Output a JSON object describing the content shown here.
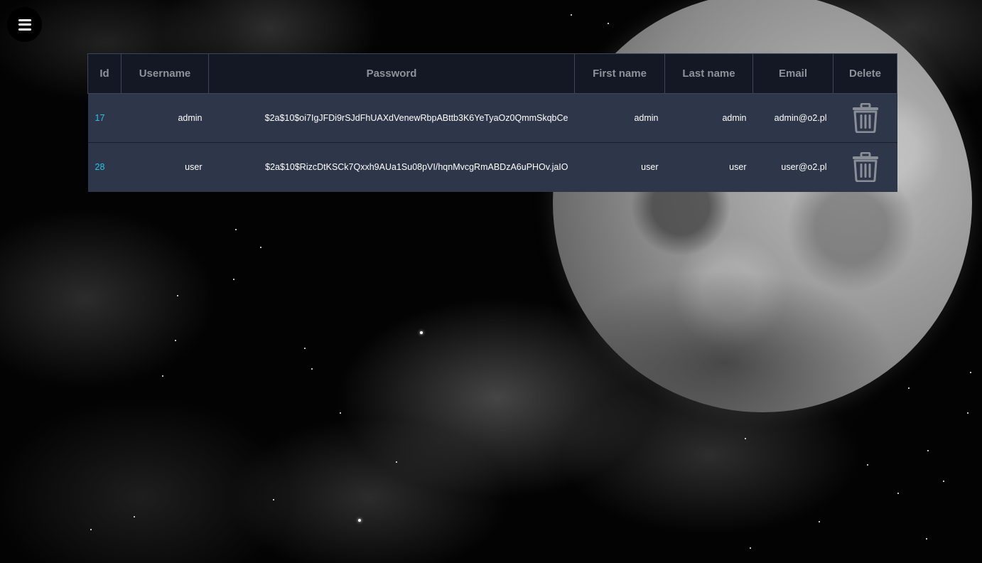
{
  "menu": {
    "icon": "hamburger-menu-icon"
  },
  "table": {
    "headers": [
      "Id",
      "Username",
      "Password",
      "First name",
      "Last name",
      "Email",
      "Delete"
    ],
    "rows": [
      {
        "id": "17",
        "username": "admin",
        "password": "$2a$10$oi7IgJFDi9rSJdFhUAXdVenewRbpABttb3K6YeTyaOz0QmmSkqbCe",
        "first_name": "admin",
        "last_name": "admin",
        "email": "admin@o2.pl",
        "delete_icon": "trash-icon"
      },
      {
        "id": "28",
        "username": "user",
        "password": "$2a$10$RizcDtKSCk7Qxxh9AUa1Su08pVI/hqnMvcgRmABDzA6uPHOv.jaIO",
        "first_name": "user",
        "last_name": "user",
        "email": "user@o2.pl",
        "delete_icon": "trash-icon"
      }
    ]
  },
  "colors": {
    "header_bg": "#141824",
    "header_text": "#8d929b",
    "row_bg": "#2e3649",
    "id_text": "#2fc2e6",
    "cell_text": "#ffffff",
    "icon_gray": "#8a8e96"
  }
}
